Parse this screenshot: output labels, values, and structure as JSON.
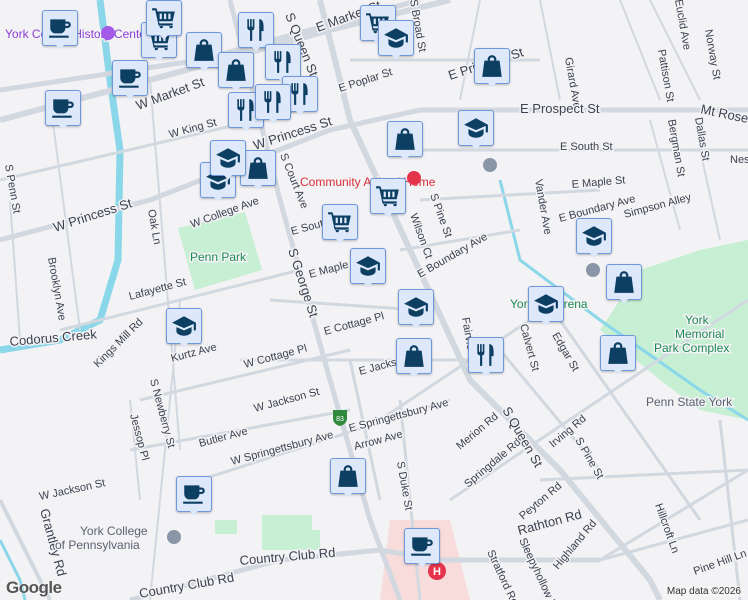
{
  "colors": {
    "marker_bg": "#dde8fb",
    "marker_border": "#6e98d9",
    "marker_icon": "#0d3f63",
    "park": "#c6efd4",
    "creek": "#8bd7ea",
    "road": "#d2d8e0",
    "highway_shield": "#2f8a3e",
    "hospital": "#e5344a"
  },
  "streets": [
    "E Market St",
    "E Princess St",
    "S Queen St",
    "S Broad St",
    "Girard Ave",
    "Pattison St",
    "Euclid Ave",
    "Norway St",
    "E Poplar St",
    "E Prospect St",
    "Mt Rose Ave",
    "Vander Ave",
    "Bergman St",
    "Dallas St",
    "E South St",
    "E Maple St",
    "E Boundary Ave",
    "Simpson Alley",
    "E Cottage Pl",
    "W Market St",
    "W King St",
    "W Princess St",
    "W College Ave",
    "S Court Ave",
    "S George St",
    "E South St",
    "E Maple St",
    "Wilson Ct",
    "S Pine St",
    "E Boundary Ave",
    "Lafayette St",
    "W Cottage Pl",
    "E Cottage Pl",
    "E Jackson St",
    "W Jackson St",
    "Kurtz Ave",
    "Kings Mill Rd",
    "S Newberry St",
    "Jessop Pl",
    "Butler Ave",
    "W Springettsbury Ave",
    "E Springettsbury Ave",
    "Arrow Ave",
    "S Duke St",
    "Merion Rd",
    "Springdale Rd",
    "Irving Rd",
    "Calvert St",
    "Edgar St",
    "Peyton Rd",
    "Rathton Rd",
    "Highland Rd",
    "Sleepyhollow Rd",
    "Stratford Rd",
    "Hillcroft Ln",
    "Pine Hill Ln",
    "Country Club Rd",
    "Grantley Rd",
    "W Jackson St",
    "Brooklyn Ave",
    "Oak Ln",
    "S Penn St",
    "Codorus Creek",
    "Fairview St",
    "Nes"
  ],
  "places": {
    "history_center": "York County History Center",
    "animal_home": "Community Animal Home",
    "penn_park": "Penn Park",
    "york_arena": "York Ice Arena",
    "memorial_park": [
      "York",
      "Memorial",
      "Park Complex"
    ],
    "penn_state": "Penn State York",
    "college": [
      "York College",
      "of Pennsylvania"
    ]
  },
  "highway_shield": "83",
  "markers": [
    {
      "type": "coffee"
    },
    {
      "type": "coffee"
    },
    {
      "type": "coffee"
    },
    {
      "type": "coffee"
    },
    {
      "type": "coffee"
    },
    {
      "type": "cart"
    },
    {
      "type": "cart"
    },
    {
      "type": "cart"
    },
    {
      "type": "cart"
    },
    {
      "type": "cart"
    },
    {
      "type": "bag"
    },
    {
      "type": "bag"
    },
    {
      "type": "bag"
    },
    {
      "type": "bag"
    },
    {
      "type": "bag"
    },
    {
      "type": "bag"
    },
    {
      "type": "bag"
    },
    {
      "type": "bag"
    },
    {
      "type": "bag"
    },
    {
      "type": "restaurant"
    },
    {
      "type": "restaurant"
    },
    {
      "type": "restaurant"
    },
    {
      "type": "restaurant"
    },
    {
      "type": "restaurant"
    },
    {
      "type": "restaurant"
    },
    {
      "type": "school"
    },
    {
      "type": "school"
    },
    {
      "type": "school"
    },
    {
      "type": "school"
    },
    {
      "type": "school"
    },
    {
      "type": "school"
    },
    {
      "type": "school"
    },
    {
      "type": "school"
    },
    {
      "type": "school"
    }
  ],
  "logo": "Google",
  "attribution": "Map data ©2026"
}
